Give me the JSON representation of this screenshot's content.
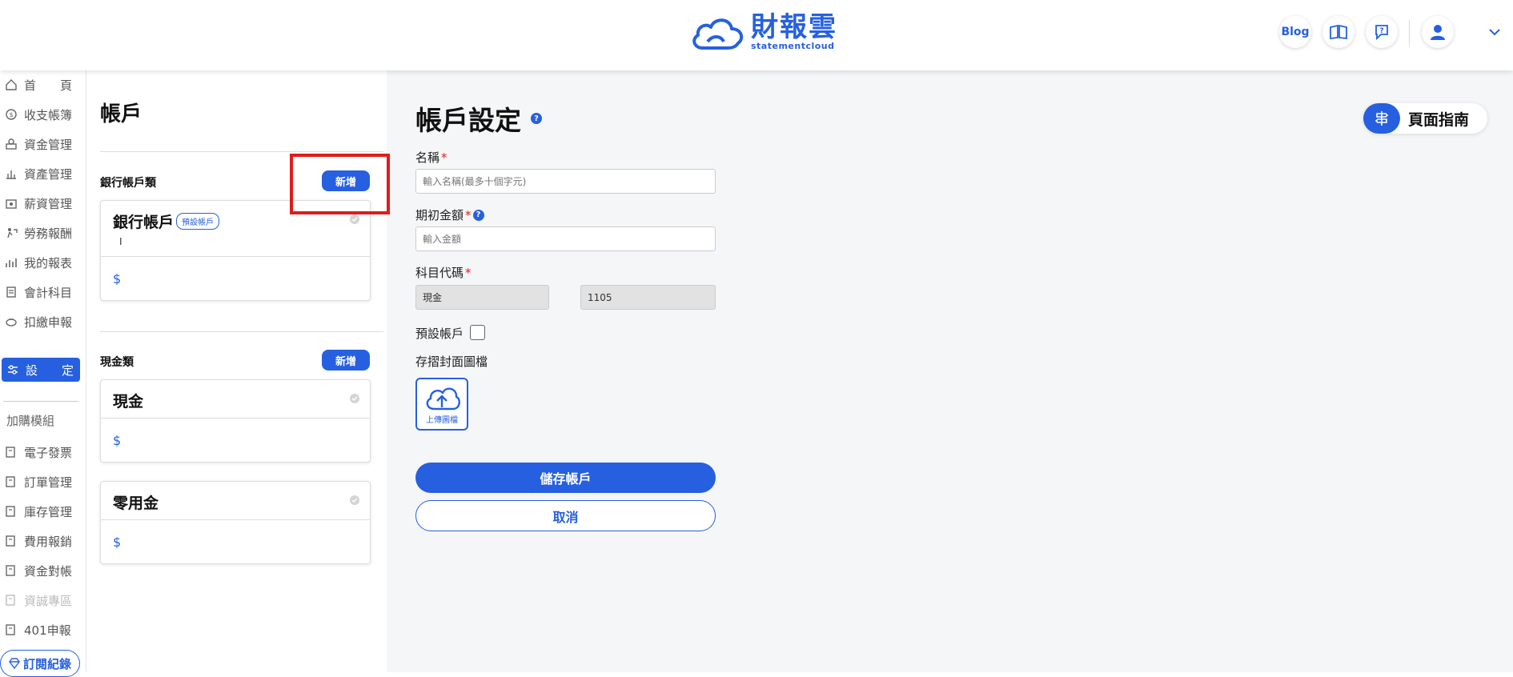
{
  "header": {
    "logo_main": "財報雲",
    "logo_sub": "statementcloud",
    "blog_label": "Blog"
  },
  "sidebar": {
    "items": [
      {
        "label": "首　　頁",
        "icon": "home-icon"
      },
      {
        "label": "收支帳簿",
        "icon": "ledger-icon"
      },
      {
        "label": "資金管理",
        "icon": "fund-icon"
      },
      {
        "label": "資產管理",
        "icon": "asset-icon"
      },
      {
        "label": "薪資管理",
        "icon": "salary-icon"
      },
      {
        "label": "勞務報酬",
        "icon": "labor-icon"
      },
      {
        "label": "我的報表",
        "icon": "report-icon"
      },
      {
        "label": "會計科目",
        "icon": "account-icon"
      },
      {
        "label": "扣繳申報",
        "icon": "withholding-icon"
      },
      {
        "label": "設　　定",
        "icon": "settings-icon",
        "active": true
      }
    ],
    "addon_section": "加購模組",
    "addons": [
      {
        "label": "電子發票"
      },
      {
        "label": "訂單管理"
      },
      {
        "label": "庫存管理"
      },
      {
        "label": "費用報銷"
      },
      {
        "label": "資金對帳"
      },
      {
        "label": "資誠專區"
      },
      {
        "label": "401申報"
      }
    ],
    "subscription_label": "訂閱紀錄"
  },
  "accounts": {
    "title": "帳戶",
    "groups": [
      {
        "label": "銀行帳戶類",
        "add_label": "新增",
        "cards": [
          {
            "name": "銀行帳戶",
            "badge": "預設帳戶",
            "sub": "I",
            "amount": "$"
          }
        ]
      },
      {
        "label": "現金類",
        "add_label": "新增",
        "cards": [
          {
            "name": "現金",
            "amount": "$"
          },
          {
            "name": "零用金",
            "amount": "$"
          }
        ]
      }
    ]
  },
  "form": {
    "title": "帳戶設定",
    "guide_label": "頁面指南",
    "name_label": "名稱",
    "name_placeholder": "輸入名稱(最多十個字元)",
    "opening_label": "期初金額",
    "opening_placeholder": "輸入金額",
    "subject_label": "科目代碼",
    "subject_name": "現金",
    "subject_code": "1105",
    "default_label": "預設帳戶",
    "cover_label": "存摺封面圖檔",
    "upload_label": "上傳圖檔",
    "save_label": "儲存帳戶",
    "cancel_label": "取消"
  },
  "colors": {
    "accent": "#2660e0",
    "highlight": "#e01c1c"
  }
}
